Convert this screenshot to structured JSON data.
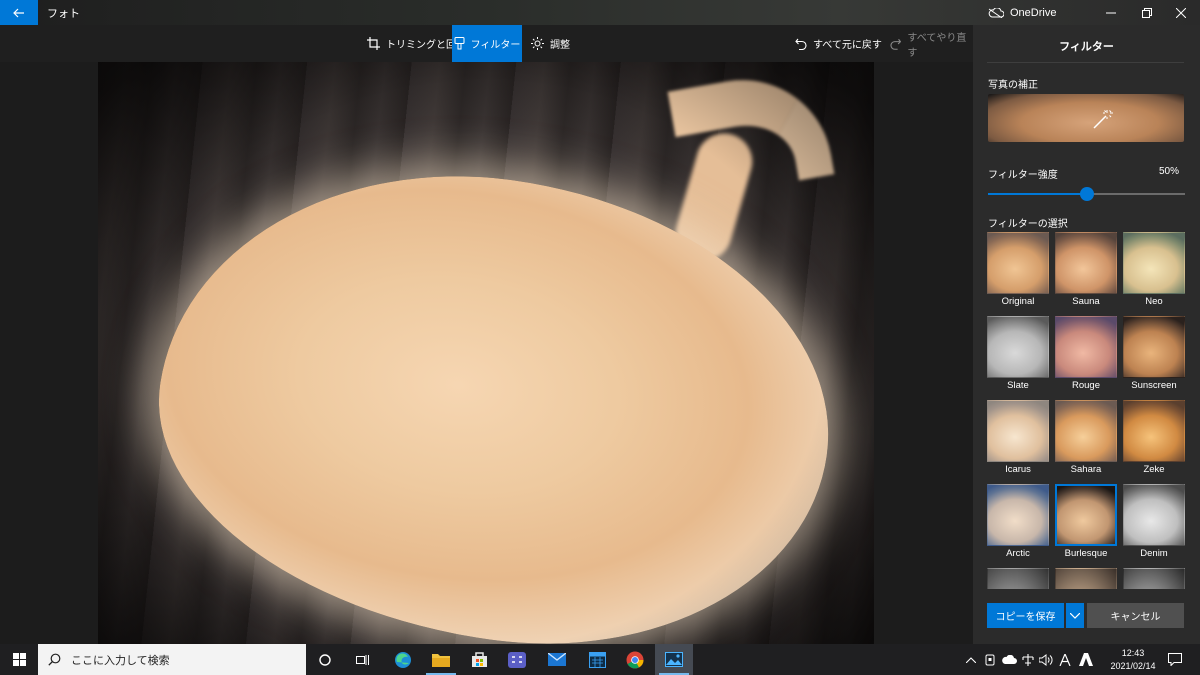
{
  "app": {
    "title": "フォト",
    "onedrive_label": "OneDrive",
    "accent": "#0078d7"
  },
  "toolbar": {
    "crop_label": "トリミングと回転",
    "filter_label": "フィルター",
    "adjust_label": "調整",
    "undo_all_label": "すべて元に戻す",
    "redo_all_label": "すべてやり直す"
  },
  "panel": {
    "title": "フィルター",
    "enhance_label": "写真の補正",
    "intensity_label": "フィルター強度",
    "intensity_value": "50%",
    "intensity_fraction": 0.5,
    "choose_label": "フィルターの選択",
    "filters": [
      {
        "name": "Original"
      },
      {
        "name": "Sauna"
      },
      {
        "name": "Neo"
      },
      {
        "name": "Slate"
      },
      {
        "name": "Rouge"
      },
      {
        "name": "Sunscreen"
      },
      {
        "name": "Icarus"
      },
      {
        "name": "Sahara"
      },
      {
        "name": "Zeke"
      },
      {
        "name": "Arctic"
      },
      {
        "name": "Burlesque"
      },
      {
        "name": "Denim"
      }
    ],
    "selected_filter": "Burlesque",
    "save_copy_label": "コピーを保存",
    "cancel_label": "キャンセル"
  },
  "taskbar": {
    "search_placeholder": "ここに入力して検索",
    "time": "12:43",
    "date": "2021/02/14"
  }
}
